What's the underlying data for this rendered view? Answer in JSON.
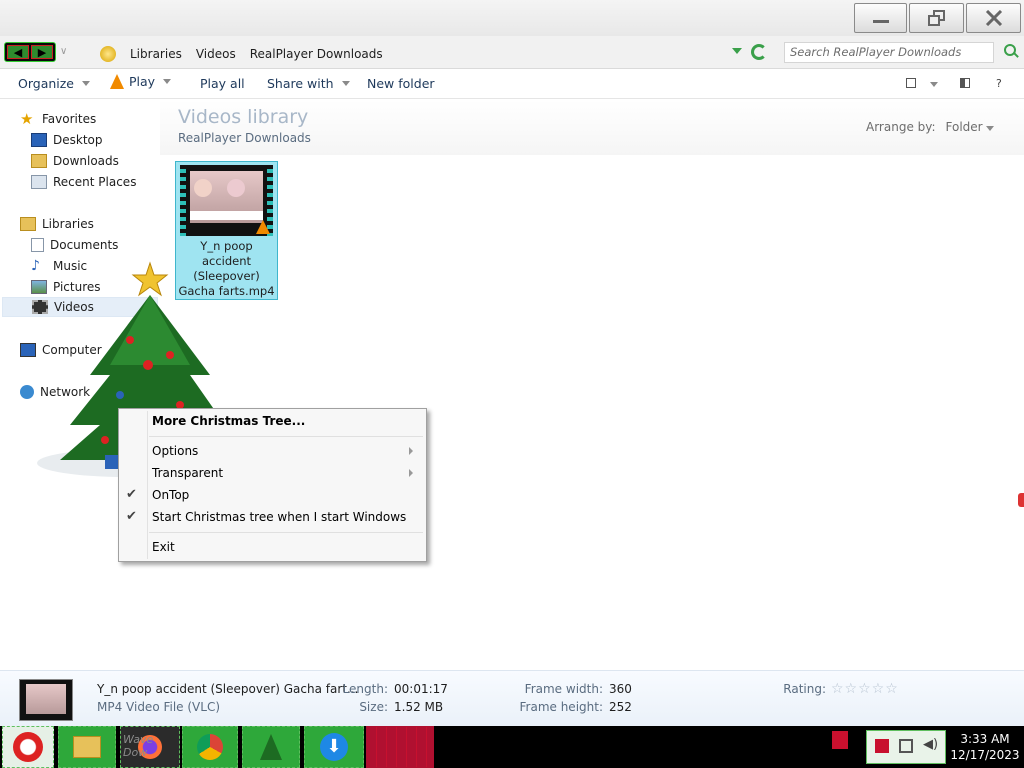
{
  "window": {
    "minimize_icon": "minimize-icon",
    "maximize_icon": "restore-icon",
    "close_icon": "close-icon"
  },
  "address_bar": {
    "breadcrumbs": [
      "Libraries",
      "Videos",
      "RealPlayer Downloads"
    ],
    "search_placeholder": "Search RealPlayer Downloads"
  },
  "toolbar": {
    "organize": "Organize",
    "play": "Play",
    "play_all": "Play all",
    "share_with": "Share with",
    "new_folder": "New folder",
    "help": "?"
  },
  "sidebar": {
    "favorites": "Favorites",
    "desktop": "Desktop",
    "downloads": "Downloads",
    "recent_places": "Recent Places",
    "libraries": "Libraries",
    "documents": "Documents",
    "music": "Music",
    "pictures": "Pictures",
    "videos": "Videos",
    "computer": "Computer",
    "network": "Network"
  },
  "library": {
    "title": "Videos library",
    "subtitle": "RealPlayer Downloads",
    "arrange_label": "Arrange by:",
    "arrange_value": "Folder"
  },
  "file": {
    "name_line1": "Y_n poop",
    "name_line2": "accident",
    "name_line3": "(Sleepover)",
    "name_line4": "Gacha farts.mp4"
  },
  "context_menu": {
    "more": "More Christmas Tree...",
    "options": "Options",
    "transparent": "Transparent",
    "ontop": "OnTop",
    "startup": "Start Christmas tree when I start Windows",
    "exit": "Exit"
  },
  "details": {
    "filename": "Y_n poop accident (Sleepover) Gacha fart...",
    "filetype": "MP4 Video File (VLC)",
    "length_label": "Length:",
    "length_value": "00:01:17",
    "size_label": "Size:",
    "size_value": "1.52 MB",
    "frame_width_label": "Frame width:",
    "frame_width_value": "360",
    "frame_height_label": "Frame height:",
    "frame_height_value": "252",
    "rating_label": "Rating:",
    "rating_stars": "☆☆☆☆☆"
  },
  "taskbar": {
    "clock_time": "3:33 AM",
    "clock_date": "12/17/2023",
    "faded_text": "Wave Dow"
  }
}
